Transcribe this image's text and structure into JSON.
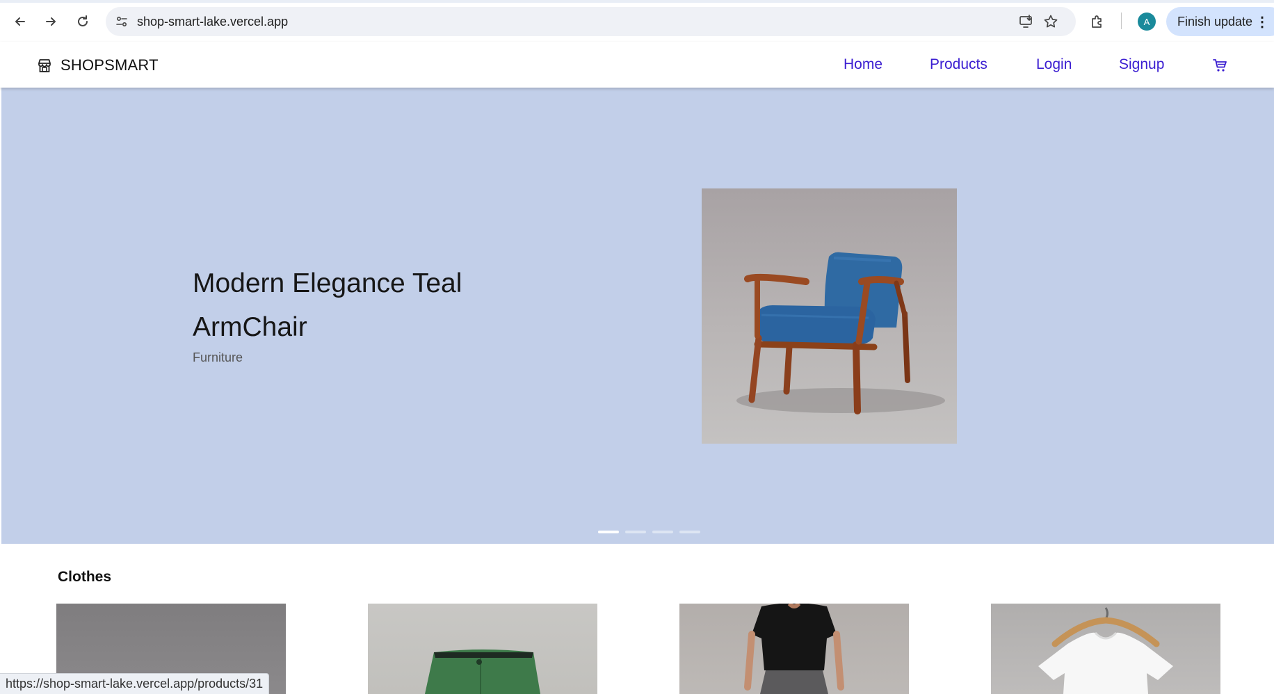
{
  "browser": {
    "url": "shop-smart-lake.vercel.app",
    "update_label": "Finish update",
    "avatar_letter": "A",
    "status_url": "https://shop-smart-lake.vercel.app/products/31"
  },
  "header": {
    "brand": "SHOPSMART",
    "nav": [
      "Home",
      "Products",
      "Login",
      "Signup"
    ],
    "cart_icon": "cart-icon"
  },
  "hero": {
    "title": "Modern Elegance Teal ArmChair",
    "category": "Furniture",
    "slides_total": 4,
    "slide_active": 1
  },
  "section": {
    "title": "Clothes",
    "products": [
      {
        "image": "gray-product-photo"
      },
      {
        "image": "green-pants-photo"
      },
      {
        "image": "black-tshirt-model-photo"
      },
      {
        "image": "white-tshirt-hanger-photo"
      }
    ]
  },
  "colors": {
    "hero_bg": "#c2cfe9",
    "nav_link": "#3b1ed1",
    "update_btn": "#d3e3fd",
    "avatar": "#1a8a9b"
  }
}
